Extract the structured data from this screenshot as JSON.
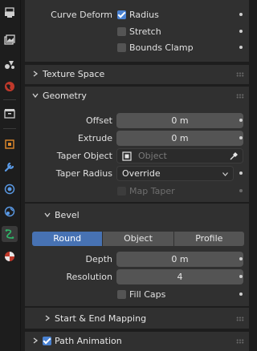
{
  "tabs": [
    {
      "icon": "tool-icon",
      "active": false
    },
    {
      "icon": "render-icon",
      "active": false
    },
    {
      "icon": "output-icon",
      "active": false
    },
    {
      "icon": "view-layer-icon",
      "active": false
    },
    {
      "icon": "scene-icon",
      "active": false
    },
    {
      "icon": "world-icon",
      "active": false
    },
    {
      "icon": "collection-icon",
      "active": false
    },
    {
      "icon": "object-icon",
      "active": false
    },
    {
      "icon": "modifier-wrench-icon",
      "active": false
    },
    {
      "icon": "particles-icon",
      "active": false
    },
    {
      "icon": "physics-icon",
      "active": false
    },
    {
      "icon": "curve-data-icon",
      "active": true
    },
    {
      "icon": "material-icon",
      "active": false
    }
  ],
  "shape_partial": {
    "curve_deform_label": "Curve Deform",
    "radius_label": "Radius",
    "radius_checked": true,
    "stretch_label": "Stretch",
    "stretch_checked": false,
    "bounds_clamp_label": "Bounds Clamp",
    "bounds_clamp_checked": false
  },
  "texture_space": {
    "title": "Texture Space",
    "expanded": false
  },
  "geometry": {
    "title": "Geometry",
    "expanded": true,
    "offset_label": "Offset",
    "offset_value": "0 m",
    "extrude_label": "Extrude",
    "extrude_value": "0 m",
    "taper_object_label": "Taper Object",
    "taper_object_placeholder": "Object",
    "taper_radius_label": "Taper Radius",
    "taper_radius_value": "Override",
    "map_taper_label": "Map Taper",
    "map_taper_checked": false
  },
  "bevel": {
    "title": "Bevel",
    "expanded": true,
    "modes": [
      "Round",
      "Object",
      "Profile"
    ],
    "active_mode": "Round",
    "depth_label": "Depth",
    "depth_value": "0 m",
    "resolution_label": "Resolution",
    "resolution_value": "4",
    "fill_caps_label": "Fill Caps",
    "fill_caps_checked": false
  },
  "start_end_mapping": {
    "title": "Start & End Mapping",
    "expanded": false
  },
  "path_animation": {
    "title": "Path Animation",
    "expanded": false,
    "enabled": true
  },
  "colors": {
    "background": "#1d1d1d",
    "panel": "#303030",
    "field": "#545454",
    "accent": "#4772b3",
    "checkbox_on": "#4a82d2",
    "curve_tab": "#2fb86a"
  }
}
